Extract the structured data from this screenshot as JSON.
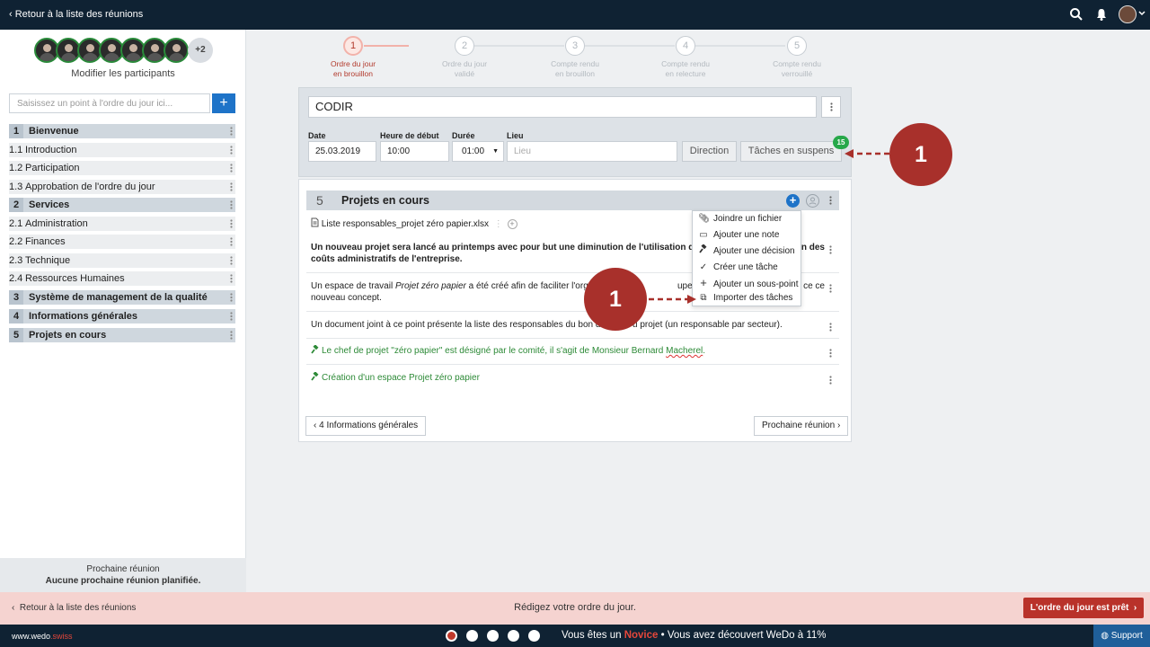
{
  "topbar": {
    "back_label": "Retour à la liste des réunions",
    "search_icon": "search-icon",
    "bell_icon": "bell-icon",
    "avatar_icon": "user-avatar"
  },
  "sidebar": {
    "participants_extra": "+2",
    "edit_participants": "Modifier les participants",
    "agenda_placeholder": "Saisissez un point à l'ordre du jour ici...",
    "add_label": "+",
    "items": [
      {
        "num": "1",
        "label": "Bienvenue",
        "section": true
      },
      {
        "num": "1.1",
        "label": "Introduction",
        "section": false
      },
      {
        "num": "1.2",
        "label": "Participation",
        "section": false
      },
      {
        "num": "1.3",
        "label": "Approbation de l'ordre du jour",
        "section": false
      },
      {
        "num": "2",
        "label": "Services",
        "section": true
      },
      {
        "num": "2.1",
        "label": "Administration",
        "section": false
      },
      {
        "num": "2.2",
        "label": "Finances",
        "section": false
      },
      {
        "num": "2.3",
        "label": "Technique",
        "section": false
      },
      {
        "num": "2.4",
        "label": "Ressources Humaines",
        "section": false
      },
      {
        "num": "3",
        "label": "Système de management de la qualité",
        "section": true
      },
      {
        "num": "4",
        "label": "Informations générales",
        "section": true
      },
      {
        "num": "5",
        "label": "Projets en cours",
        "section": true
      }
    ],
    "next_meeting_title": "Prochaine réunion",
    "next_meeting_value": "Aucune prochaine réunion planifiée."
  },
  "steps": [
    {
      "num": "1",
      "line1": "Ordre du jour",
      "line2": "en brouillon",
      "active": true
    },
    {
      "num": "2",
      "line1": "Ordre du jour",
      "line2": "validé",
      "active": false
    },
    {
      "num": "3",
      "line1": "Compte rendu",
      "line2": "en brouillon",
      "active": false
    },
    {
      "num": "4",
      "line1": "Compte rendu",
      "line2": "en relecture",
      "active": false
    },
    {
      "num": "5",
      "line1": "Compte rendu",
      "line2": "verrouillé",
      "active": false
    }
  ],
  "meeting": {
    "title": "CODIR",
    "date_label": "Date",
    "date_value": "25.03.2019",
    "start_label": "Heure de début",
    "start_value": "10:00",
    "duration_label": "Durée",
    "duration_value": "01:00",
    "location_label": "Lieu",
    "location_placeholder": "Lieu",
    "direction_button": "Direction",
    "pending_tasks_button": "Tâches en suspens",
    "pending_tasks_count": "15"
  },
  "item": {
    "num": "5",
    "title": "Projets en cours",
    "attachment": "Liste responsables_projet zéro papier.xlsx",
    "para1": "Un nouveau projet sera lancé au printemps avec pour but une diminution de l'utilisation du",
    "para1_tail": "n des",
    "para1_line2": "coûts administratifs de l'entreprise.",
    "para2_a": "Un espace de travail ",
    "para2_em": "Projet zéro papier",
    "para2_b": " a été créé afin de faciliter l'organ",
    "para2_tail": "upe de travai",
    "para2_tail2": "ce ce",
    "para2_line2": "nouveau concept.",
    "para3_a": "Un document joint à ce point présente la liste des responsables du bon dér",
    "para3_b": "u projet (un responsable par secteur).",
    "decision1_a": "Le chef de projet \"zéro papier\" est désigné par le comité, il s'agit de Monsieur Bernard ",
    "decision1_b": "Macherel",
    "decision1_c": ".",
    "decision2": "Création d'un espace Projet zéro papier"
  },
  "menu": [
    {
      "icon": "paperclip-icon",
      "label": "Joindre un fichier"
    },
    {
      "icon": "note-icon",
      "label": "Ajouter une note"
    },
    {
      "icon": "gavel-icon",
      "label": "Ajouter une décision"
    },
    {
      "icon": "check-icon",
      "label": "Créer une tâche"
    },
    {
      "icon": "plus-icon",
      "label": "Ajouter un sous-point"
    },
    {
      "icon": "import-icon",
      "label": "Importer des tâches"
    }
  ],
  "nav": {
    "prev": "‹ 4 Informations générales",
    "next": "Prochaine réunion ›"
  },
  "callouts": [
    "1",
    "1"
  ],
  "statusbar": {
    "back_label": "Retour à la liste des réunions",
    "message": "Rédigez votre ordre du jour.",
    "ready_button": "L'ordre du jour est prêt"
  },
  "bottombar": {
    "brand_a": "www.wedo",
    "brand_b": ".swiss",
    "msg_a": "Vous êtes un ",
    "msg_level": "Novice",
    "msg_b": " • Vous avez découvert WeDo à 11%",
    "support": "Support"
  },
  "colors": {
    "accent": "#1e73c8",
    "danger": "#a8302b",
    "dark": "#0f2233",
    "success": "#27a84a"
  }
}
